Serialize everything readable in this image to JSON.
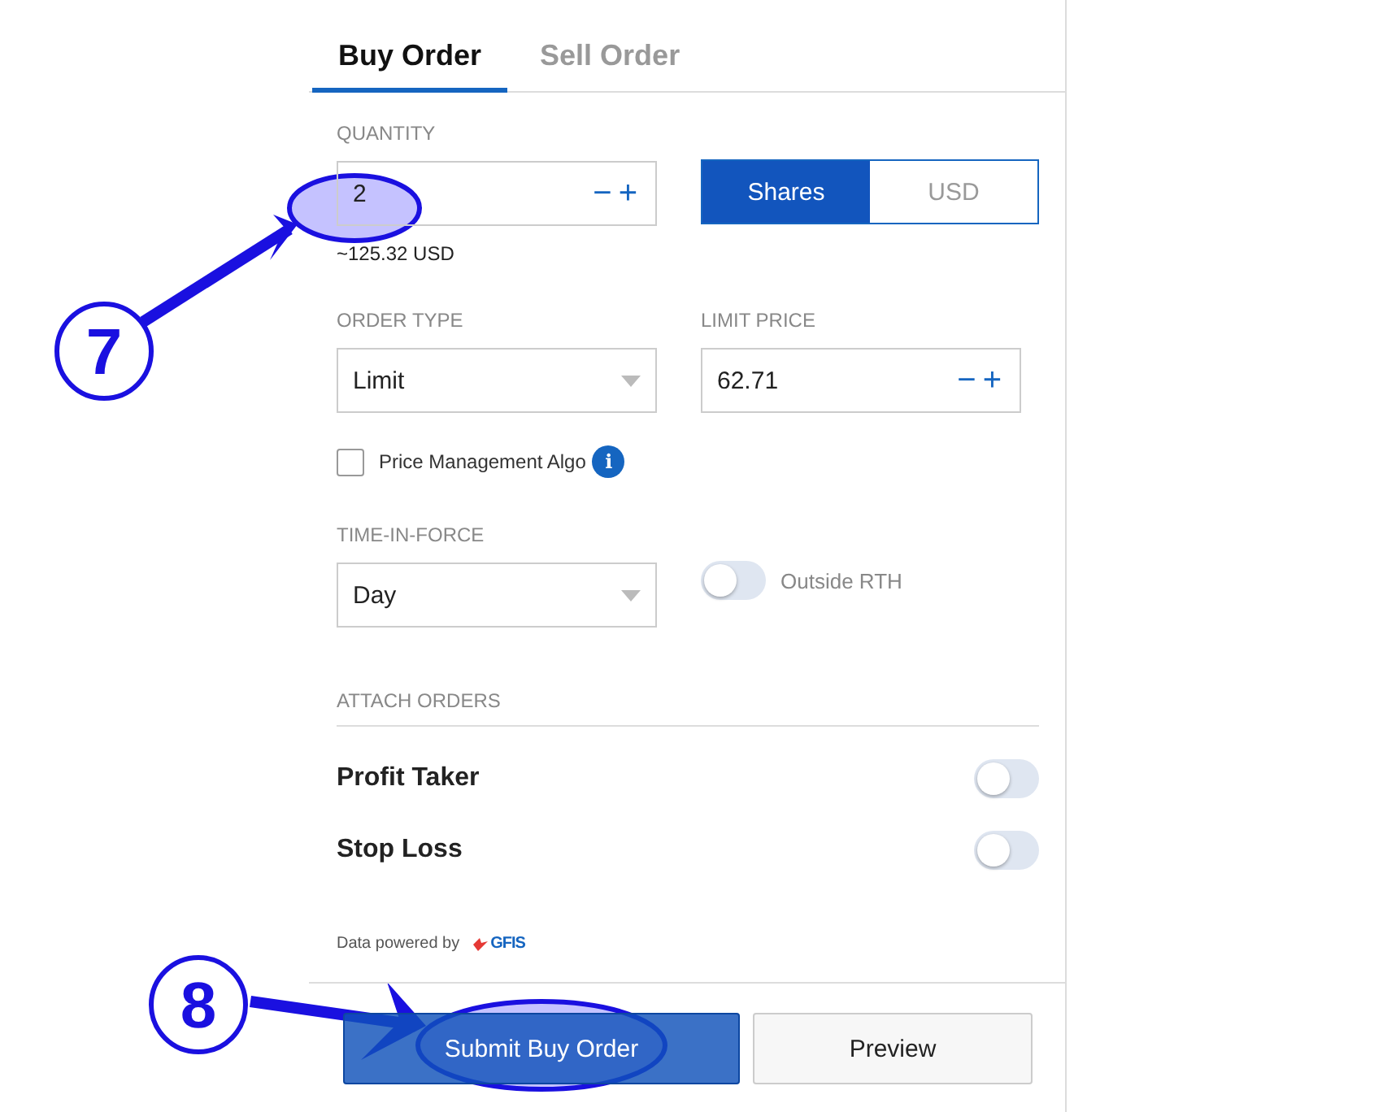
{
  "tabs": [
    {
      "label": "Buy Order",
      "selected": true
    },
    {
      "label": "Sell Order",
      "selected": false
    }
  ],
  "quantity": {
    "label": "QUANTITY",
    "value": "2",
    "minus": "−",
    "plus": "+",
    "estimate": "~125.32 USD",
    "units": [
      {
        "label": "Shares",
        "selected": true
      },
      {
        "label": "USD",
        "selected": false
      }
    ]
  },
  "order_type": {
    "label": "ORDER TYPE",
    "value": "Limit"
  },
  "limit_price": {
    "label": "LIMIT PRICE",
    "value": "62.71",
    "minus": "−",
    "plus": "+"
  },
  "price_management_algo": {
    "label": "Price Management Algo",
    "checked": false,
    "info": "i"
  },
  "time_in_force": {
    "label": "TIME-IN-FORCE",
    "value": "Day"
  },
  "outside_rth": {
    "label": "Outside RTH",
    "on": false
  },
  "attach_orders": {
    "label": "ATTACH ORDERS",
    "items": [
      {
        "label": "Profit Taker",
        "on": false
      },
      {
        "label": "Stop Loss",
        "on": false
      }
    ]
  },
  "footer": {
    "text": "Data powered by",
    "brand": "GFIS"
  },
  "buttons": [
    {
      "label": "Submit Buy Order",
      "kind": "primary"
    },
    {
      "label": "Preview",
      "kind": "secondary"
    }
  ],
  "annotations": [
    {
      "number": "7"
    },
    {
      "number": "8"
    }
  ]
}
